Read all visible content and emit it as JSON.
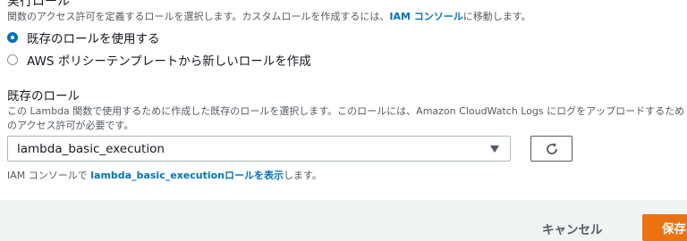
{
  "execution_role": {
    "title": "実行ロール",
    "description_prefix": "関数のアクセス許可を定義するロールを選択します。カスタムロールを作成するには、",
    "iam_console_link": "IAM コンソール",
    "description_suffix": "に移動します。",
    "options": [
      {
        "label": "既存のロールを使用する",
        "selected": true
      },
      {
        "label": "AWS ポリシーテンプレートから新しいロールを作成",
        "selected": false
      }
    ]
  },
  "existing_role": {
    "label": "既存のロール",
    "description": "この Lambda 関数で使用するために作成した既存のロールを選択します。このロールには、Amazon CloudWatch Logs にログをアップロードするためのアクセス許可が必要です。",
    "selected_value": "lambda_basic_execution",
    "refresh_icon": "refresh-icon",
    "hint_prefix": "IAM コンソールで ",
    "hint_link": "lambda_basic_executionロールを表示",
    "hint_suffix": "します。"
  },
  "footer": {
    "cancel_label": "キャンセル",
    "save_label": "保存"
  },
  "colors": {
    "accent": "#0073bb",
    "primary_button": "#ec7211",
    "footer_bg": "#f2f3f3"
  }
}
